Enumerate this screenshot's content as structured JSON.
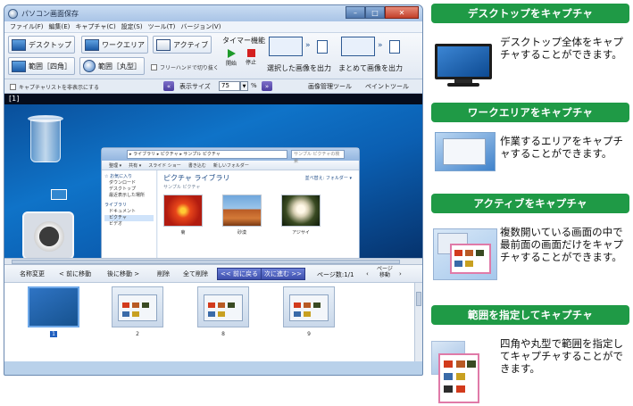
{
  "window": {
    "title": "パソコン画面保存"
  },
  "menu": [
    "ファイル(F)",
    "編集(E)",
    "キャプチャ(C)",
    "設定(S)",
    "ツール(T)",
    "バージョン(V)"
  ],
  "toolbar": {
    "desktop": "デスクトップ",
    "workarea": "ワークエリア",
    "active": "アクティブ",
    "timer": "タイマー機能",
    "start": "開始",
    "stop": "停止",
    "rect_range": "範囲［四角］",
    "round_range": "範囲［丸型］",
    "freehand": "フリーハンドで切り抜く",
    "output_selected": "選択した画像を出力",
    "output_all": "まとめて画像を出力"
  },
  "subbar": {
    "hide_list": "キャプチャリストを非表示にする",
    "display_size": "表示サイズ",
    "size_value": "75",
    "percent": "%",
    "image_tool": "画像管理ツール",
    "paint_tool": "ペイントツール"
  },
  "preview": {
    "index": "[1]"
  },
  "explorer": {
    "address": "▸ ライブラリ ▸ ピクチャ ▸ サンプル ピクチャ",
    "search": "サンプル ピクチャの検索",
    "cmd": [
      "整理 ▾",
      "共有 ▾",
      "スライド ショー",
      "書き込む",
      "新しいフォルダー"
    ],
    "nav": [
      "☆ お気に入り",
      "ダウンロード",
      "デスクトップ",
      "最近表示した場所",
      "ライブラリ",
      "ドキュメント",
      "ピクチャ",
      "ビデオ"
    ],
    "heading": "ピクチャ ライブラリ",
    "subheading": "サンプル ピクチャ",
    "arrange": "並べ替え: フォルダー ▾",
    "pics": [
      "菊",
      "砂漠",
      "アジサイ"
    ]
  },
  "pager": {
    "rename": "名称変更",
    "move_prev": "< 前に移動",
    "move_next": "後に移動 >",
    "delete": "削除",
    "delete_all": "全て削除",
    "prev": "<< 前に戻る",
    "next": "次に進む >>",
    "page_count": "ページ数:1/1",
    "page_move": "ページ 移動"
  },
  "thumbnails": [
    "1",
    "2",
    "8",
    "9"
  ],
  "features": [
    {
      "heading": "デスクトップをキャプチャ",
      "desc": "デスクトップ全体をキャプチャすることができます。"
    },
    {
      "heading": "ワークエリアをキャプチャ",
      "desc": "作業するエリアをキャプチャすることができます。"
    },
    {
      "heading": "アクティブをキャプチャ",
      "desc": "複数開いている画面の中で最前面の画面だけをキャプチャすることができます。"
    },
    {
      "heading": "範囲を指定してキャプチャ",
      "desc": "四角や丸型で範囲を指定してキャプチャすることができます。"
    }
  ],
  "colors": {
    "feature_green": "#1f9a46",
    "desktop_blue": "#0f73c8",
    "nav_purple": "#4b3d9e"
  }
}
